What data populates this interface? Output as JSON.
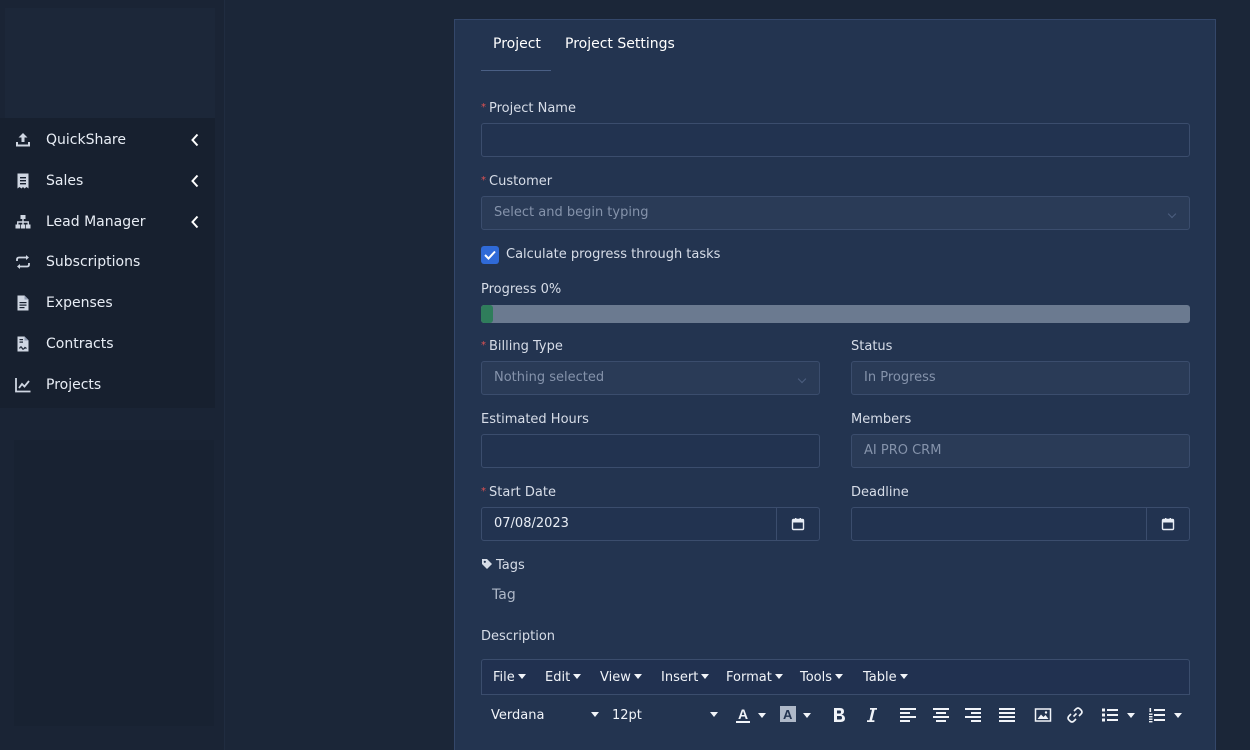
{
  "sidebar": {
    "items": [
      {
        "label": "QuickShare",
        "icon": "upload-icon",
        "has_submenu": true
      },
      {
        "label": "Sales",
        "icon": "receipt-icon",
        "has_submenu": true
      },
      {
        "label": "Lead Manager",
        "icon": "sitemap-icon",
        "has_submenu": true
      },
      {
        "label": "Subscriptions",
        "icon": "repeat-icon",
        "has_submenu": false
      },
      {
        "label": "Expenses",
        "icon": "file-text-icon",
        "has_submenu": false
      },
      {
        "label": "Contracts",
        "icon": "file-contract-icon",
        "has_submenu": false
      },
      {
        "label": "Projects",
        "icon": "chart-line-icon",
        "has_submenu": false
      }
    ]
  },
  "tabs": [
    {
      "label": "Project",
      "active": true
    },
    {
      "label": "Project Settings",
      "active": false
    }
  ],
  "form": {
    "project_name": {
      "label": "Project Name",
      "required": true,
      "value": ""
    },
    "customer": {
      "label": "Customer",
      "required": true,
      "placeholder": "Select and begin typing"
    },
    "calculate_progress": {
      "label": "Calculate progress through tasks",
      "checked": true
    },
    "progress": {
      "label": "Progress 0%",
      "percent": 0
    },
    "billing_type": {
      "label": "Billing Type",
      "required": true,
      "placeholder": "Nothing selected"
    },
    "status": {
      "label": "Status",
      "value": "In Progress"
    },
    "estimated_hours": {
      "label": "Estimated Hours",
      "value": ""
    },
    "members": {
      "label": "Members",
      "value": "AI PRO CRM"
    },
    "start_date": {
      "label": "Start Date",
      "required": true,
      "value": "07/08/2023"
    },
    "deadline": {
      "label": "Deadline",
      "value": ""
    },
    "tags": {
      "label": "Tags",
      "placeholder": "Tag"
    },
    "description": {
      "label": "Description"
    }
  },
  "editor": {
    "menus": [
      "File",
      "Edit",
      "View",
      "Insert",
      "Format",
      "Tools",
      "Table"
    ],
    "font_family": "Verdana",
    "font_size": "12pt"
  },
  "colors": {
    "accent": "#2f6ad8",
    "progress_fill": "#2f7d5b",
    "required": "#e05252"
  }
}
